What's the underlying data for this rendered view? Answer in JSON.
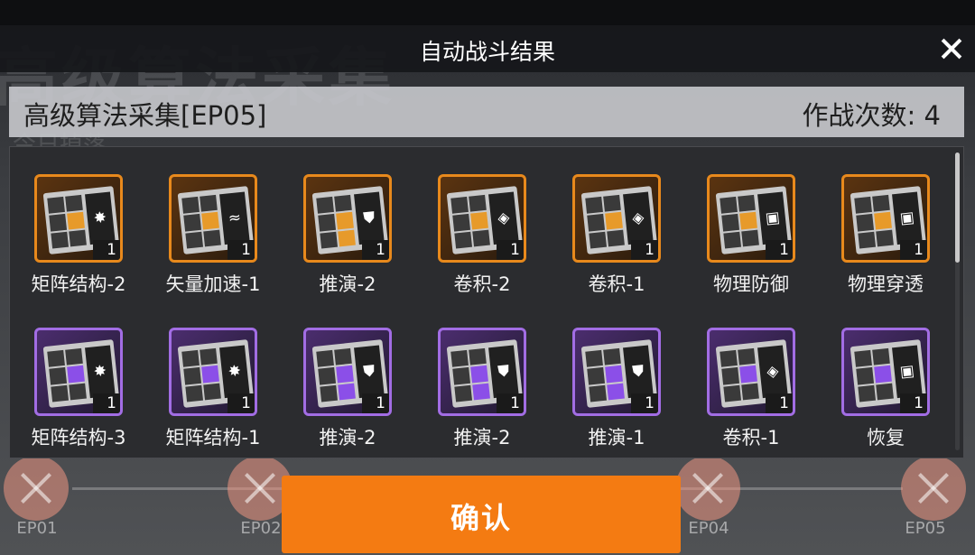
{
  "background": {
    "title": "高级算法采集",
    "subtitle": "今日掉落",
    "stages": [
      "EP01",
      "EP02",
      "",
      "EP04",
      "EP05"
    ]
  },
  "modal": {
    "title": "自动战斗结果",
    "stage_name": "高级算法采集[EP05]",
    "battle_count": "作战次数: 4",
    "confirm_label": "确认"
  },
  "colors": {
    "orange_rarity": "#e8891c",
    "purple_rarity": "#a26de4",
    "confirm": "#f47b12"
  },
  "items": [
    {
      "name": "矩阵结构-2",
      "qty": "1",
      "rarity": "orange",
      "icon": "star-burst-icon"
    },
    {
      "name": "矢量加速-1",
      "qty": "1",
      "rarity": "orange",
      "icon": "chevrons-icon"
    },
    {
      "name": "推演-2",
      "qty": "1",
      "rarity": "orange",
      "icon": "shield-icon"
    },
    {
      "name": "卷积-2",
      "qty": "1",
      "rarity": "orange",
      "icon": "diamond-icon"
    },
    {
      "name": "卷积-1",
      "qty": "1",
      "rarity": "orange",
      "icon": "diamond-icon"
    },
    {
      "name": "物理防御",
      "qty": "1",
      "rarity": "orange",
      "icon": "squares-icon"
    },
    {
      "name": "物理穿透",
      "qty": "1",
      "rarity": "orange",
      "icon": "squares-icon"
    },
    {
      "name": "矩阵结构-3",
      "qty": "1",
      "rarity": "purple",
      "icon": "star-burst-icon"
    },
    {
      "name": "矩阵结构-1",
      "qty": "1",
      "rarity": "purple",
      "icon": "star-burst-icon"
    },
    {
      "name": "推演-2",
      "qty": "1",
      "rarity": "purple",
      "icon": "shield-icon"
    },
    {
      "name": "推演-2",
      "qty": "1",
      "rarity": "purple",
      "icon": "shield-icon"
    },
    {
      "name": "推演-1",
      "qty": "1",
      "rarity": "purple",
      "icon": "shield-icon"
    },
    {
      "name": "卷积-1",
      "qty": "1",
      "rarity": "purple",
      "icon": "diamond-icon"
    },
    {
      "name": "恢复",
      "qty": "1",
      "rarity": "purple",
      "icon": "squares-icon"
    }
  ]
}
